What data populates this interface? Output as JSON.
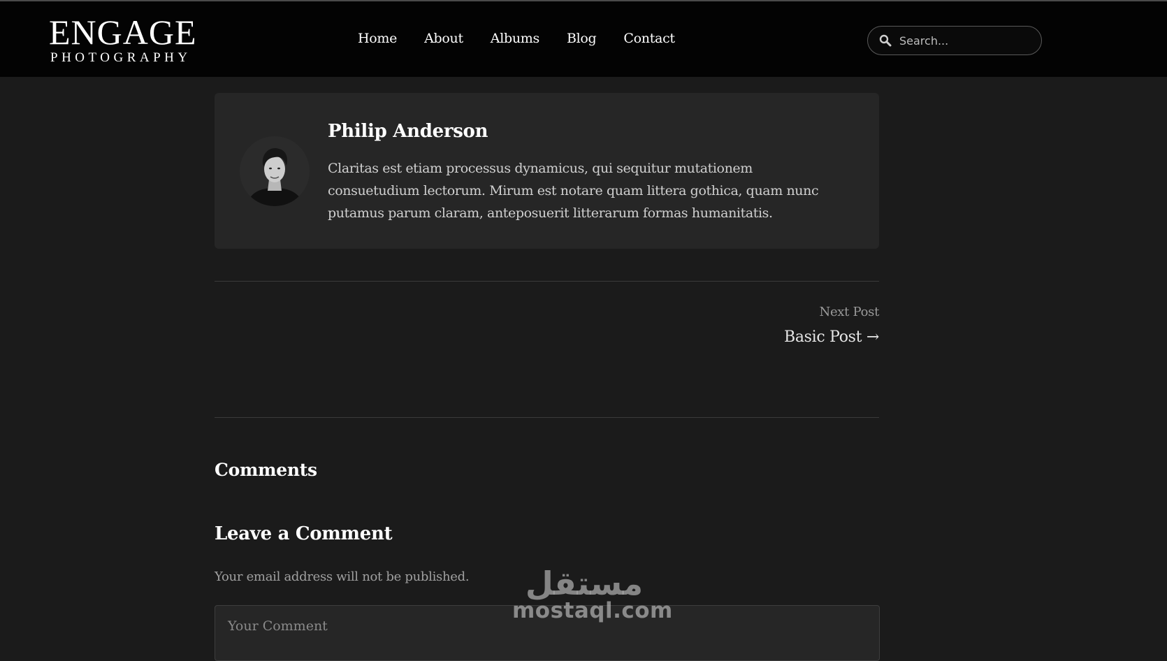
{
  "header": {
    "logo_main": "ENGAGE",
    "logo_sub": "PHOTOGRAPHY",
    "nav": [
      "Home",
      "About",
      "Albums",
      "Blog",
      "Contact"
    ],
    "search_placeholder": "Search...",
    "search_icon": "search-icon"
  },
  "author": {
    "name": "Philip Anderson",
    "bio": "Claritas est etiam processus dynamicus, qui sequitur mutationem consuetudium lectorum. Mirum est notare quam littera gothica, quam nunc putamus parum claram, anteposuerit litterarum formas humanitatis."
  },
  "post_nav": {
    "next_label": "Next Post",
    "next_title": "Basic Post →"
  },
  "comments": {
    "title": "Comments",
    "leave_title": "Leave a Comment",
    "email_note": "Your email address will not be published.",
    "comment_placeholder": "Your Comment"
  },
  "watermark": {
    "arabic": "مستقل",
    "latin": "mostaql.com"
  },
  "colors": {
    "header_bg": "#030303",
    "page_bg": "#1b1b1b",
    "card_bg": "#262626",
    "text": "#ffffff",
    "muted": "#9a9a9a"
  }
}
